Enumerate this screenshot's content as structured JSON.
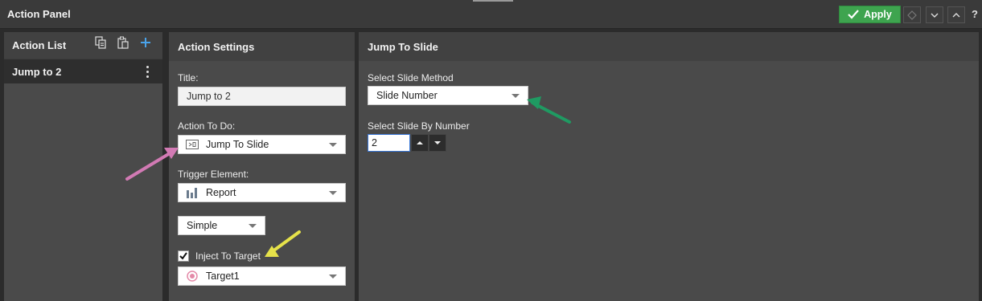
{
  "header": {
    "title": "Action Panel",
    "apply_label": "Apply",
    "help_label": "?"
  },
  "action_list": {
    "title": "Action List",
    "items": [
      {
        "label": "Jump to 2"
      }
    ]
  },
  "settings": {
    "title": "Action Settings",
    "title_label": "Title:",
    "title_value": "Jump to 2",
    "action_label": "Action To Do:",
    "action_value": "Jump To Slide",
    "trigger_label": "Trigger Element:",
    "trigger_value": "Report",
    "mode_value": "Simple",
    "inject_label": "Inject To Target",
    "inject_checked": true,
    "target_value": "Target1"
  },
  "jump": {
    "title": "Jump To Slide",
    "method_label": "Select Slide Method",
    "method_value": "Slide Number",
    "number_label": "Select Slide By Number",
    "number_value": "2"
  },
  "colors": {
    "apply_green": "#3ea44f",
    "arrow_pink": "#d27ab4",
    "arrow_yellow": "#e6e24a",
    "arrow_green": "#1f9a62"
  },
  "icons": [
    "check-icon",
    "diamond-icon",
    "chevron-down-icon",
    "chevron-up-icon",
    "copy-icon",
    "paste-icon",
    "plus-icon",
    "kebab-icon",
    "slide-action-icon",
    "bar-chart-icon",
    "target-icon",
    "checkbox-check-icon",
    "spin-up-icon",
    "spin-down-icon"
  ]
}
